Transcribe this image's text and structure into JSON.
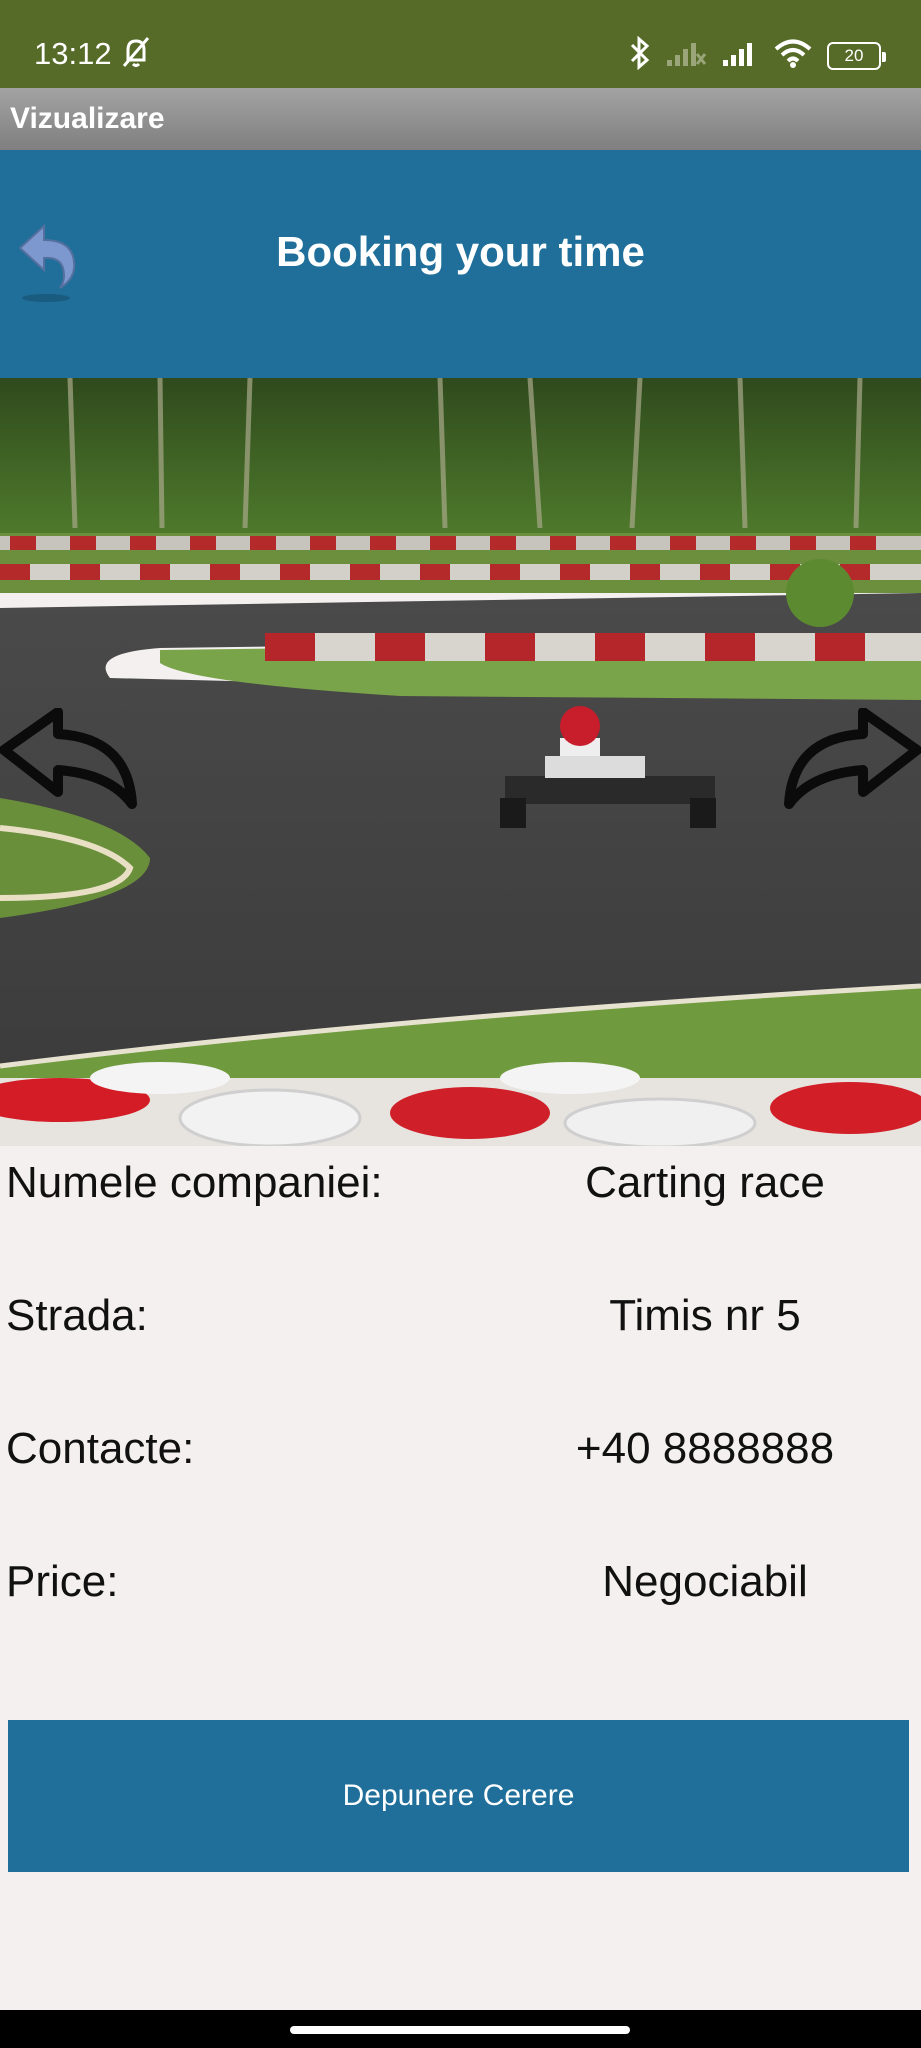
{
  "status_bar": {
    "time": "13:12",
    "battery": "20",
    "icons": [
      "bell-off-icon",
      "bluetooth-icon",
      "signal-off-icon",
      "signal-icon",
      "wifi-icon",
      "battery-icon"
    ]
  },
  "app_bar": {
    "title": "Vizualizare"
  },
  "header": {
    "title": "Booking your time",
    "back_icon": "back-arrow-icon"
  },
  "gallery": {
    "image": "go-kart-race-track-photo",
    "prev_icon": "arrow-left-icon",
    "next_icon": "arrow-right-icon"
  },
  "details": [
    {
      "label": "Numele companiei:",
      "value": "Carting race"
    },
    {
      "label": "Strada:",
      "value": "Timis nr 5"
    },
    {
      "label": "Contacte:",
      "value": "+40 8888888"
    },
    {
      "label": "Price:",
      "value": "Negociabil"
    }
  ],
  "actions": {
    "submit_label": "Depunere Cerere"
  },
  "colors": {
    "status_bar": "#566b28",
    "header": "#1f6f9a",
    "button": "#1f6f9a",
    "background": "#f4f0ef"
  }
}
